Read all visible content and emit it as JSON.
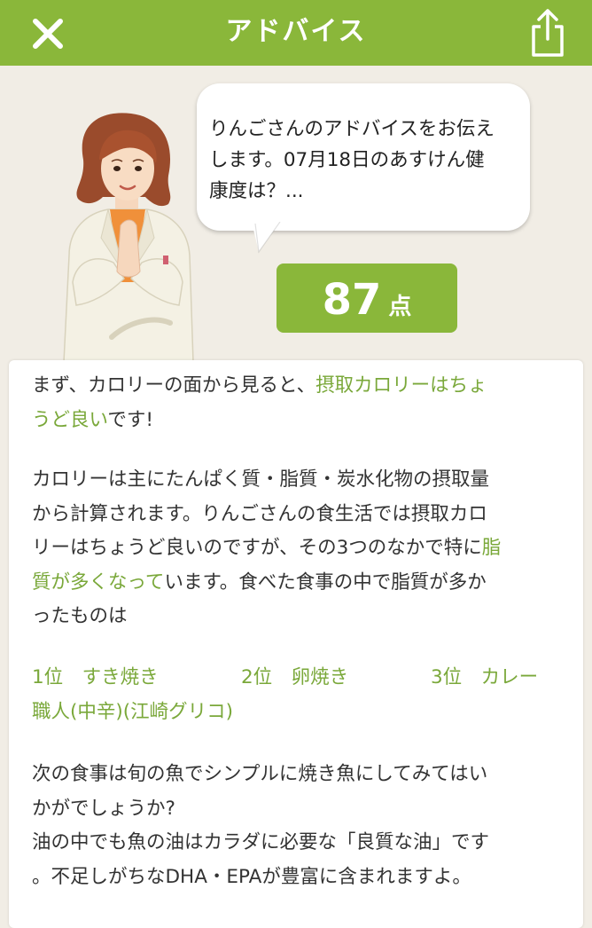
{
  "header": {
    "title": "アドバイス",
    "close_icon": "close-icon",
    "share_icon": "share-icon",
    "color": "#8ab73a"
  },
  "bubble": {
    "line1": "りんごさんのアドバイスをお伝え",
    "line2": "します。07月18日のあすけん健",
    "line3": "康度は？..."
  },
  "score": {
    "value": "87",
    "unit": "点"
  },
  "advice": {
    "p1": {
      "t1": "まず、カロリーの面から見ると、",
      "h1": "摂取カロリーはちょ",
      "h2": "うど良い",
      "t2": "です!"
    },
    "p2": {
      "l1": "カロリーは主にたんぱく質・脂質・炭水化物の摂取量",
      "l2": "から計算されます。りんごさんの食生活では摂取カロ",
      "l3a": "リーはちょうど良いのですが、その3つのなかで特に",
      "l3h": "脂",
      "l4h": "質が多くなって",
      "l4b": "います。食べた食事の中で脂質が多か",
      "l5": "ったものは"
    },
    "ranking": {
      "r1": "1位　すき焼き",
      "r2": "2位　卵焼き",
      "r3": "3位　カレー",
      "r3_cont": "職人(中辛)(江崎グリコ)"
    },
    "p3": {
      "l1": "次の食事は旬の魚でシンプルに焼き魚にしてみてはい",
      "l2": "かがでしょうか?",
      "l3": "油の中でも魚の油はカラダに必要な「良質な油」です",
      "l4": "。不足しがちなDHA・EPAが豊富に含まれますよ。"
    }
  }
}
